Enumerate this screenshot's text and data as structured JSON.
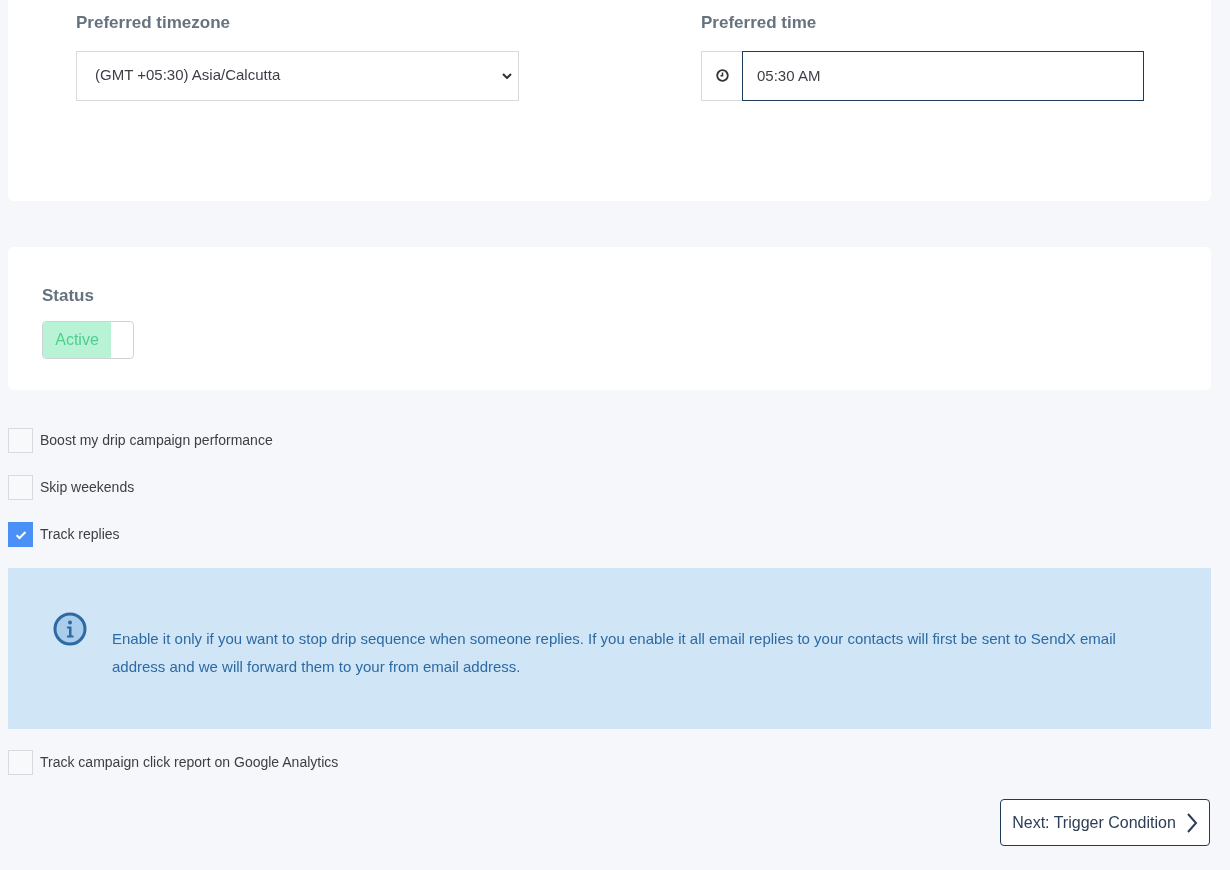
{
  "schedule": {
    "timezone": {
      "label": "Preferred timezone",
      "value": "(GMT +05:30) Asia/Calcutta"
    },
    "time": {
      "label": "Preferred time",
      "value": "05:30 AM"
    }
  },
  "status": {
    "label": "Status",
    "toggle": {
      "text": "Active",
      "on": true
    }
  },
  "options": [
    {
      "kind": "checkbox",
      "label": "Boost my drip campaign performance",
      "checked": false
    },
    {
      "kind": "checkbox",
      "label": "Skip weekends",
      "checked": false
    },
    {
      "kind": "checkbox",
      "label": "Track replies",
      "checked": true
    },
    {
      "kind": "note",
      "text": "Enable it only if you want to stop drip sequence when someone replies. If you enable it all email replies to your contacts will first be sent to SendX email address and we will forward them to your from email address."
    },
    {
      "kind": "checkbox",
      "label": "Track campaign click report on Google Analytics",
      "checked": false
    }
  ],
  "next_button": "Next: Trigger Condition"
}
